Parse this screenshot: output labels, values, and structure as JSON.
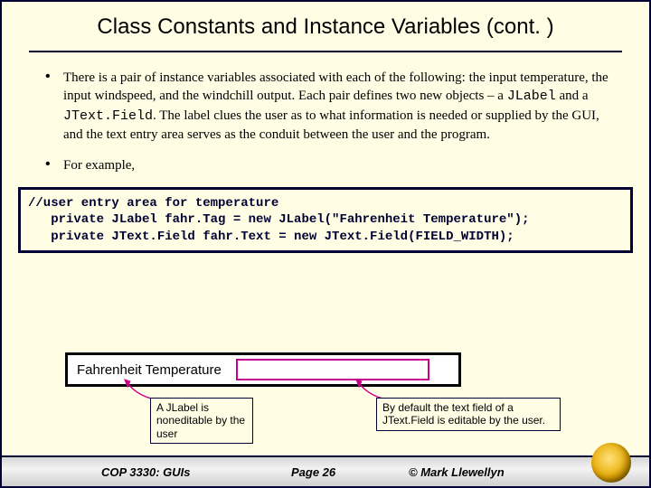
{
  "title": "Class Constants and Instance Variables (cont. )",
  "bullets": {
    "p1a": "There is a pair of instance variables associated with each of the following: the input temperature, the input windspeed, and the windchill output. Each pair defines two new objects – a ",
    "p1b": "JLabel",
    "p1c": " and a ",
    "p1d": "JText.Field",
    "p1e": ". The label clues the user as to what information is needed or supplied by the GUI, and the text entry area serves as the conduit between the user and the program.",
    "p2": "For example,"
  },
  "code": "//user entry area for temperature\n   private JLabel fahr.Tag = new JLabel(\"Fahrenheit Temperature\");\n   private JText.Field fahr.Text = new JText.Field(FIELD_WIDTH);",
  "example": {
    "label": "Fahrenheit Temperature"
  },
  "callout_left": "A JLabel is noneditable by the user",
  "callout_right": "By default the text field of a JText.Field is editable by the user.",
  "footer": {
    "left": "COP 3330: GUIs",
    "mid": "Page 26",
    "right": "© Mark Llewellyn"
  }
}
